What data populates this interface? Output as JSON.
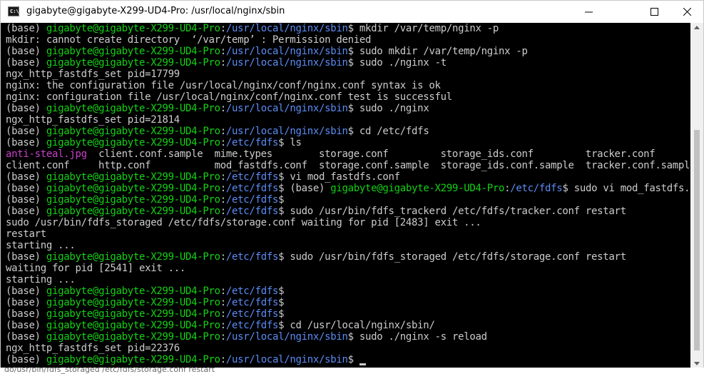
{
  "window": {
    "title": "gigabyte@gigabyte-X299-UD4-Pro: /usr/local/nginx/sbin",
    "app_icon_text": "C:\\"
  },
  "colors": {
    "user_host": "#13d213",
    "path": "#5b8cf5",
    "image_file": "#c940c9",
    "text": "#cccccc",
    "background": "#000000"
  },
  "terminal": {
    "lines": [
      [
        {
          "t": "(base) ",
          "c": "w"
        },
        {
          "t": "gigabyte@gigabyte-X299-UD4-Pro",
          "c": "g"
        },
        {
          "t": ":",
          "c": "w"
        },
        {
          "t": "/usr/local/nginx/sbin",
          "c": "b"
        },
        {
          "t": "$ mkdir /var/temp/nginx -p",
          "c": "w"
        }
      ],
      [
        {
          "t": "mkdir: cannot create directory  ‘/var/temp’ : Permission denied",
          "c": "w"
        }
      ],
      [
        {
          "t": "(base) ",
          "c": "w"
        },
        {
          "t": "gigabyte@gigabyte-X299-UD4-Pro",
          "c": "g"
        },
        {
          "t": ":",
          "c": "w"
        },
        {
          "t": "/usr/local/nginx/sbin",
          "c": "b"
        },
        {
          "t": "$ sudo mkdir /var/temp/nginx -p",
          "c": "w"
        }
      ],
      [
        {
          "t": "(base) ",
          "c": "w"
        },
        {
          "t": "gigabyte@gigabyte-X299-UD4-Pro",
          "c": "g"
        },
        {
          "t": ":",
          "c": "w"
        },
        {
          "t": "/usr/local/nginx/sbin",
          "c": "b"
        },
        {
          "t": "$ sudo ./nginx -t",
          "c": "w"
        }
      ],
      [
        {
          "t": "ngx_http_fastdfs_set pid=17799",
          "c": "w"
        }
      ],
      [
        {
          "t": "nginx: the configuration file /usr/local/nginx/conf/nginx.conf syntax is ok",
          "c": "w"
        }
      ],
      [
        {
          "t": "nginx: configuration file /usr/local/nginx/conf/nginx.conf test is successful",
          "c": "w"
        }
      ],
      [
        {
          "t": "(base) ",
          "c": "w"
        },
        {
          "t": "gigabyte@gigabyte-X299-UD4-Pro",
          "c": "g"
        },
        {
          "t": ":",
          "c": "w"
        },
        {
          "t": "/usr/local/nginx/sbin",
          "c": "b"
        },
        {
          "t": "$ sudo ./nginx",
          "c": "w"
        }
      ],
      [
        {
          "t": "ngx_http_fastdfs_set pid=21814",
          "c": "w"
        }
      ],
      [
        {
          "t": "(base) ",
          "c": "w"
        },
        {
          "t": "gigabyte@gigabyte-X299-UD4-Pro",
          "c": "g"
        },
        {
          "t": ":",
          "c": "w"
        },
        {
          "t": "/usr/local/nginx/sbin",
          "c": "b"
        },
        {
          "t": "$ cd /etc/fdfs",
          "c": "w"
        }
      ],
      [
        {
          "t": "(base) ",
          "c": "w"
        },
        {
          "t": "gigabyte@gigabyte-X299-UD4-Pro",
          "c": "g"
        },
        {
          "t": ":",
          "c": "w"
        },
        {
          "t": "/etc/fdfs",
          "c": "b"
        },
        {
          "t": "$ ls",
          "c": "w"
        }
      ],
      [
        {
          "t": "anti-steal.jpg",
          "c": "m"
        },
        {
          "t": "  client.conf.sample  mime.types        storage.conf         storage_ids.conf         tracker.conf",
          "c": "w"
        }
      ],
      [
        {
          "t": "client.conf     http.conf           mod_fastdfs.conf  storage.conf.sample  storage_ids.conf.sample  tracker.conf.sample",
          "c": "w"
        }
      ],
      [
        {
          "t": "(base) ",
          "c": "w"
        },
        {
          "t": "gigabyte@gigabyte-X299-UD4-Pro",
          "c": "g"
        },
        {
          "t": ":",
          "c": "w"
        },
        {
          "t": "/etc/fdfs",
          "c": "b"
        },
        {
          "t": "$ vi mod_fastdfs.conf",
          "c": "w"
        }
      ],
      [
        {
          "t": "(base) ",
          "c": "w"
        },
        {
          "t": "gigabyte@gigabyte-X299-UD4-Pro",
          "c": "g"
        },
        {
          "t": ":",
          "c": "w"
        },
        {
          "t": "/etc/fdfs",
          "c": "b"
        },
        {
          "t": "$ (base) ",
          "c": "w"
        },
        {
          "t": "gigabyte@gigabyte-X299-UD4-Pro",
          "c": "g"
        },
        {
          "t": ":",
          "c": "w"
        },
        {
          "t": "/etc/fdfs",
          "c": "b"
        },
        {
          "t": "$ sudo vi mod_fastdfs.co",
          "c": "w"
        }
      ],
      [
        {
          "t": "(base) ",
          "c": "w"
        },
        {
          "t": "gigabyte@gigabyte-X299-UD4-Pro",
          "c": "g"
        },
        {
          "t": ":",
          "c": "w"
        },
        {
          "t": "/etc/fdfs",
          "c": "b"
        },
        {
          "t": "$",
          "c": "w"
        }
      ],
      [
        {
          "t": "(base) ",
          "c": "w"
        },
        {
          "t": "gigabyte@gigabyte-X299-UD4-Pro",
          "c": "g"
        },
        {
          "t": ":",
          "c": "w"
        },
        {
          "t": "/etc/fdfs",
          "c": "b"
        },
        {
          "t": "$ sudo /usr/bin/fdfs_trackerd /etc/fdfs/tracker.conf restart",
          "c": "w"
        }
      ],
      [
        {
          "t": "sudo /usr/bin/fdfs_storaged /etc/fdfs/storage.conf waiting for pid [2483] exit ...",
          "c": "w"
        }
      ],
      [
        {
          "t": "restart",
          "c": "w"
        }
      ],
      [
        {
          "t": "starting ...",
          "c": "w"
        }
      ],
      [
        {
          "t": "(base) ",
          "c": "w"
        },
        {
          "t": "gigabyte@gigabyte-X299-UD4-Pro",
          "c": "g"
        },
        {
          "t": ":",
          "c": "w"
        },
        {
          "t": "/etc/fdfs",
          "c": "b"
        },
        {
          "t": "$ sudo /usr/bin/fdfs_storaged /etc/fdfs/storage.conf restart",
          "c": "w"
        }
      ],
      [
        {
          "t": "waiting for pid [2541] exit ...",
          "c": "w"
        }
      ],
      [
        {
          "t": "starting ...",
          "c": "w"
        }
      ],
      [
        {
          "t": "(base) ",
          "c": "w"
        },
        {
          "t": "gigabyte@gigabyte-X299-UD4-Pro",
          "c": "g"
        },
        {
          "t": ":",
          "c": "w"
        },
        {
          "t": "/etc/fdfs",
          "c": "b"
        },
        {
          "t": "$",
          "c": "w"
        }
      ],
      [
        {
          "t": "(base) ",
          "c": "w"
        },
        {
          "t": "gigabyte@gigabyte-X299-UD4-Pro",
          "c": "g"
        },
        {
          "t": ":",
          "c": "w"
        },
        {
          "t": "/etc/fdfs",
          "c": "b"
        },
        {
          "t": "$",
          "c": "w"
        }
      ],
      [
        {
          "t": "(base) ",
          "c": "w"
        },
        {
          "t": "gigabyte@gigabyte-X299-UD4-Pro",
          "c": "g"
        },
        {
          "t": ":",
          "c": "w"
        },
        {
          "t": "/etc/fdfs",
          "c": "b"
        },
        {
          "t": "$",
          "c": "w"
        }
      ],
      [
        {
          "t": "(base) ",
          "c": "w"
        },
        {
          "t": "gigabyte@gigabyte-X299-UD4-Pro",
          "c": "g"
        },
        {
          "t": ":",
          "c": "w"
        },
        {
          "t": "/etc/fdfs",
          "c": "b"
        },
        {
          "t": "$ cd /usr/local/nginx/sbin/",
          "c": "w"
        }
      ],
      [
        {
          "t": "(base) ",
          "c": "w"
        },
        {
          "t": "gigabyte@gigabyte-X299-UD4-Pro",
          "c": "g"
        },
        {
          "t": ":",
          "c": "w"
        },
        {
          "t": "/usr/local/nginx/sbin",
          "c": "b"
        },
        {
          "t": "$ sudo ./nginx -s reload",
          "c": "w"
        }
      ],
      [
        {
          "t": "ngx_http_fastdfs_set pid=22376",
          "c": "w"
        }
      ],
      [
        {
          "t": "(base) ",
          "c": "w"
        },
        {
          "t": "gigabyte@gigabyte-X299-UD4-Pro",
          "c": "g"
        },
        {
          "t": ":",
          "c": "w"
        },
        {
          "t": "/usr/local/nginx/sbin",
          "c": "b"
        },
        {
          "t": "$",
          "c": "w"
        }
      ]
    ]
  },
  "background_window_text": "do/usr/bin/fdfs_storaged /etc/fdfs/storage.conf restart"
}
